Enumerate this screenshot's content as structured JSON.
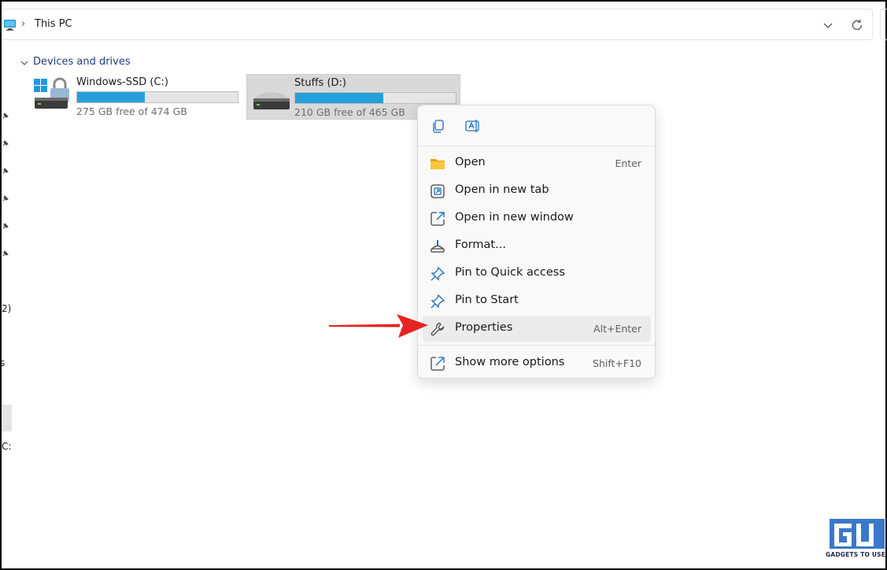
{
  "address_bar": {
    "location": "This PC",
    "separator": "›"
  },
  "section": {
    "title": "Devices and drives"
  },
  "drives": [
    {
      "name": "Windows-SSD (C:)",
      "free_text": "275 GB free of 474 GB",
      "used_fraction": 0.42
    },
    {
      "name": "Stuffs (D:)",
      "free_text": "210 GB free of 465 GB",
      "used_fraction": 0.55
    }
  ],
  "left_edge": {
    "text_1": "2)",
    "text_2": "s",
    "text_3": "C:"
  },
  "context_menu": {
    "quick_actions": [
      "copy-icon",
      "rename-icon"
    ],
    "items": [
      {
        "label": "Open",
        "shortcut": "Enter",
        "icon": "folder-icon"
      },
      {
        "label": "Open in new tab",
        "shortcut": "",
        "icon": "new-tab-icon"
      },
      {
        "label": "Open in new window",
        "shortcut": "",
        "icon": "new-window-icon"
      },
      {
        "label": "Format...",
        "shortcut": "",
        "icon": "format-icon"
      },
      {
        "label": "Pin to Quick access",
        "shortcut": "",
        "icon": "pin-icon"
      },
      {
        "label": "Pin to Start",
        "shortcut": "",
        "icon": "pin-icon"
      },
      {
        "label": "Properties",
        "shortcut": "Alt+Enter",
        "icon": "wrench-icon",
        "highlighted": true
      },
      {
        "label": "Show more options",
        "shortcut": "Shift+F10",
        "icon": "more-options-icon"
      }
    ]
  },
  "watermark": {
    "text": "GADGETS TO USE"
  },
  "colors": {
    "accent": "#26a0da",
    "arrow": "#e52421",
    "selection": "#d9d9d9"
  }
}
